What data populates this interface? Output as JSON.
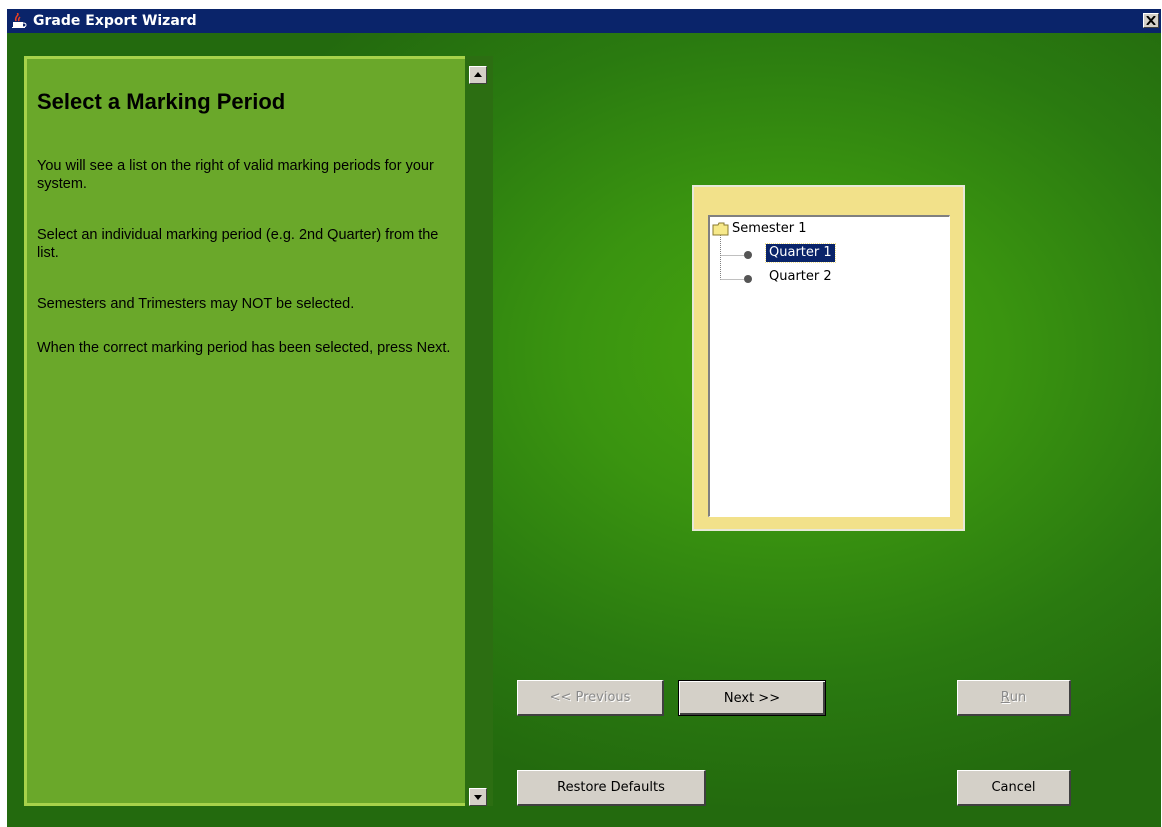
{
  "window": {
    "title": "Grade Export Wizard",
    "icon": "java-cup-icon"
  },
  "left_panel": {
    "title": "Select a Marking Period",
    "paragraphs": [
      "You will see a list on the right of valid marking periods for your system.",
      "Select an individual marking period (e.g. 2nd Quarter) from the list.",
      "Semesters and Trimesters may NOT be selected.",
      "When the correct marking period has been selected, press Next."
    ]
  },
  "tree": {
    "root": "Semester 1",
    "children": [
      "Quarter 1",
      "Quarter 2"
    ],
    "selected": "Quarter 1"
  },
  "buttons": {
    "previous": "<< Previous",
    "next": "Next >>",
    "run": "Run",
    "restore_defaults": "Restore Defaults",
    "cancel": "Cancel"
  },
  "colors": {
    "titlebar": "#0a246a",
    "left_panel": "#6aa82a",
    "background_green": "#3a9410",
    "tree_frame": "#f2e18a",
    "selection": "#0a246a"
  }
}
